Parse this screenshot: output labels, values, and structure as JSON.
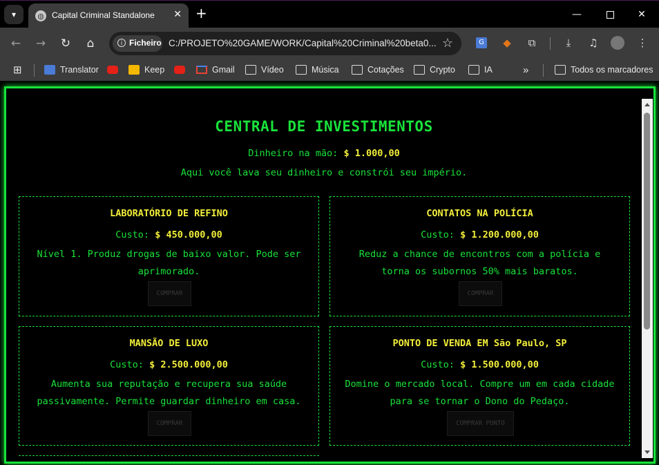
{
  "browser": {
    "tab_title": "Capital Criminal Standalone",
    "new_tab_symbol": "+",
    "site_chip": "Ficheiro",
    "url": "C:/PROJETO%20GAME/WORK/Capital%20Criminal%20beta0...",
    "bookmarks": [
      "Translator",
      "Keep",
      "Gmail",
      "Vídeo",
      "Música",
      "Cotações",
      "Crypto",
      "IA"
    ],
    "overflow": "»",
    "all_bookmarks": "Todos os marcadores"
  },
  "page": {
    "heading": "CENTRAL DE INVESTIMENTOS",
    "cash_label": "Dinheiro na mão:",
    "cash_value": "$ 1.000,00",
    "tagline": "Aqui você lava seu dinheiro e constrói seu império.",
    "cost_label": "Custo:",
    "cards": [
      {
        "title": "LABORATÓRIO DE REFINO",
        "cost": "$ 450.000,00",
        "desc": "Nível 1. Produz drogas de baixo valor. Pode ser aprimorado.",
        "button": "COMPRAR"
      },
      {
        "title": "CONTATOS NA POLÍCIA",
        "cost": "$ 1.200.000,00",
        "desc": "Reduz a chance de encontros com a polícia e torna os subornos 50% mais baratos.",
        "button": "COMPRAR"
      },
      {
        "title": "MANSÃO DE LUXO",
        "cost": "$ 2.500.000,00",
        "desc": "Aumenta sua reputação e recupera sua saúde passivamente. Permite guardar dinheiro em casa.",
        "button": "COMPRAR"
      },
      {
        "title": "PONTO DE VENDA EM São Paulo, SP",
        "cost": "$ 1.500.000,00",
        "desc": "Domine o mercado local. Compre um em cada cidade para se tornar o Dono do Pedaço.",
        "button": "COMPRAR PONTO"
      }
    ]
  },
  "colors": {
    "accent_green": "#19e23a",
    "accent_yellow": "#f2ee3a",
    "chrome_dark": "#3c3c3c"
  }
}
